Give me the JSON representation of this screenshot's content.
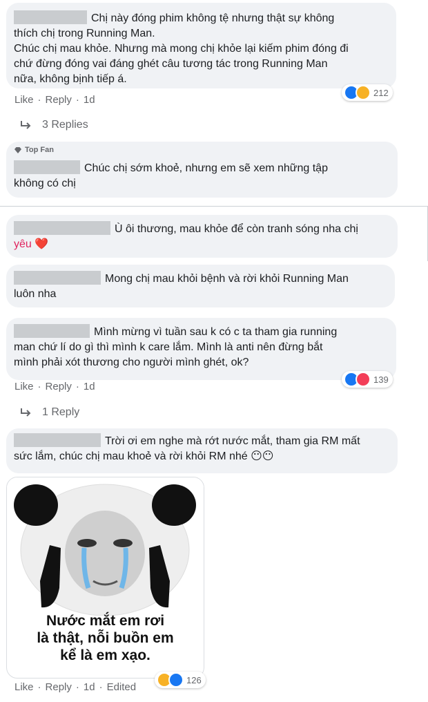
{
  "comments": [
    {
      "text_lines": [
        "Chị này đóng phim không tệ nhưng thật sự không",
        "thích chị trong Running Man.",
        "Chúc chị mau khỏe. Nhưng mà mong chị khỏe lại kiếm phim đóng đi",
        "chứ đừng đóng vai đáng ghét câu tương tác trong Running Man",
        "nữa, không bịnh tiếp á."
      ],
      "reaction_count": "212",
      "actions": {
        "like": "Like",
        "reply": "Reply",
        "time": "1d"
      },
      "replies_label": "3 Replies"
    },
    {
      "badge": "Top Fan",
      "text_lines": [
        "Chúc chị sớm khoẻ, nhưng em sẽ xem những tập",
        "không có chị"
      ]
    },
    {
      "text_lines": [
        "Ù ôi thương, mau khỏe để còn tranh sóng nha chị",
        "yêu ❤️"
      ]
    },
    {
      "text_lines": [
        "Mong chị mau khỏi bệnh và rời khỏi Running Man",
        "luôn nha"
      ]
    },
    {
      "text_lines": [
        "Mình mừng vì tuần sau k có c ta tham gia running",
        "man chứ lí do gì thì mình k care lắm. Mình là anti nên đừng bắt",
        "mình phải xót thương cho người mình ghét, ok?"
      ],
      "reaction_count": "139",
      "actions": {
        "like": "Like",
        "reply": "Reply",
        "time": "1d"
      },
      "replies_label": "1 Reply"
    },
    {
      "text_lines": [
        "Trời ơi em nghe mà rớt nước mắt, tham gia RM mất",
        "sức lắm, chúc chị mau khoẻ và rời khỏi RM nhé 😶😶"
      ],
      "meme_caption": [
        "Nước mắt em rơi",
        "là thật, nỗi buồn em",
        "kể là em xạo."
      ],
      "reaction_count": "126",
      "actions": {
        "like": "Like",
        "reply": "Reply",
        "time": "1d",
        "edited": "Edited"
      }
    }
  ],
  "colors": {
    "bubble": "#f0f2f5",
    "meta_text": "#65676b",
    "like_blue": "#1877f2",
    "haha_yellow": "#f7b125",
    "love_red": "#f33e58"
  }
}
